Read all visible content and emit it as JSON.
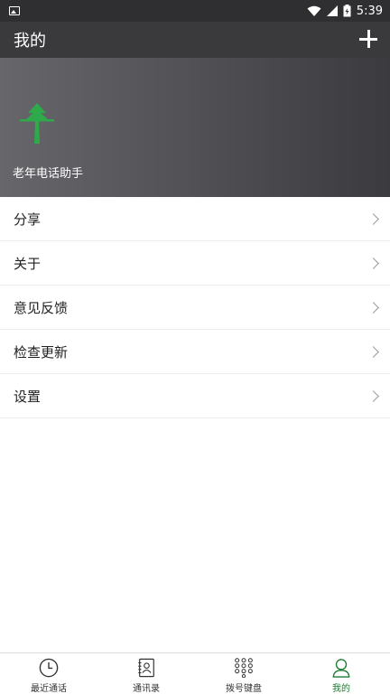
{
  "status_bar": {
    "time": "5:39",
    "icons": [
      "image-icon",
      "wifi-icon",
      "signal-icon",
      "battery-icon"
    ]
  },
  "app_bar": {
    "title": "我的",
    "action_icon": "plus-icon"
  },
  "profile": {
    "app_name": "老年电话助手",
    "logo_icon": "tree-icon",
    "logo_color": "#2faa4a"
  },
  "menu": {
    "items": [
      {
        "label": "分享"
      },
      {
        "label": "关于"
      },
      {
        "label": "意见反馈"
      },
      {
        "label": "检查更新"
      },
      {
        "label": "设置"
      }
    ]
  },
  "bottom_nav": {
    "items": [
      {
        "label": "最近通话",
        "icon": "clock-icon"
      },
      {
        "label": "通讯录",
        "icon": "contacts-icon"
      },
      {
        "label": "拨号键盘",
        "icon": "dialpad-icon"
      },
      {
        "label": "我的",
        "icon": "person-icon",
        "active": true
      }
    ],
    "active_color": "#1e7d32"
  }
}
